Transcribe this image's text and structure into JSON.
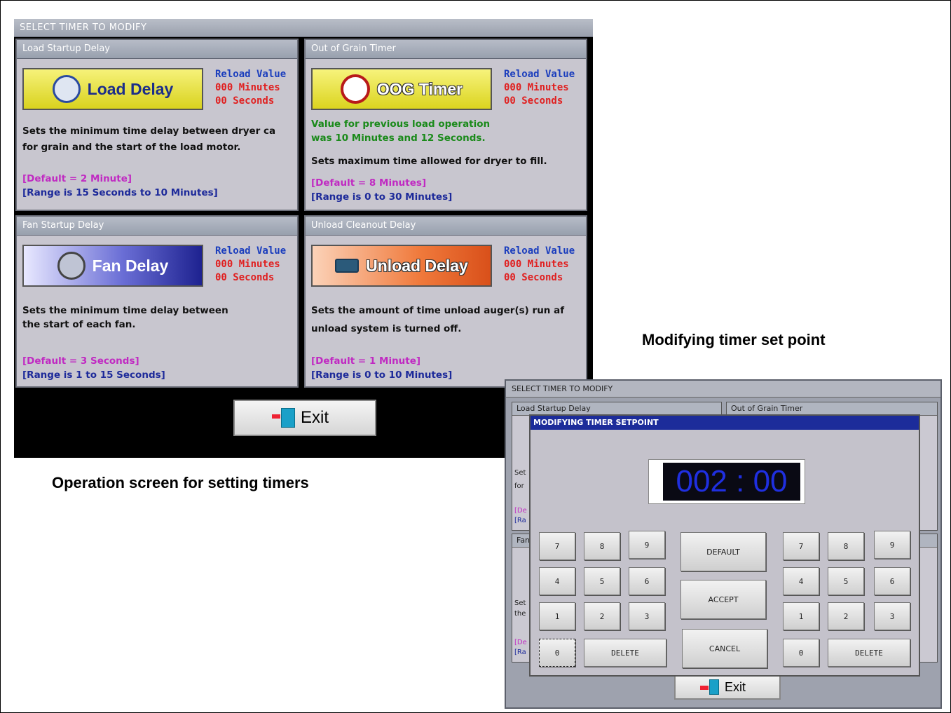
{
  "main": {
    "title": "SELECT TIMER TO MODIFY",
    "panels": [
      {
        "head": "Load Startup Delay",
        "button": "Load Delay",
        "reload": [
          "Reload Value",
          "000 Minutes",
          "00 Seconds"
        ],
        "desc1": "Sets the minimum time delay between dryer ca",
        "desc2": "for grain and the start of the load motor.",
        "default": "[Default = 2 Minute]",
        "range": "[Range is 15 Seconds to 10 Minutes]"
      },
      {
        "head": "Out of Grain Timer",
        "button": "OOG Timer",
        "reload": [
          "Reload Value",
          "000 Minutes",
          "00 Seconds"
        ],
        "prev1": "Value for previous load operation",
        "prev2": "was 10 Minutes and 12 Seconds.",
        "desc1": "Sets maximum time allowed for dryer to fill.",
        "default": "[Default = 8 Minutes]",
        "range": "[Range is 0 to 30 Minutes]"
      },
      {
        "head": "Fan Startup Delay",
        "button": "Fan Delay",
        "reload": [
          "Reload Value",
          "000 Minutes",
          "00 Seconds"
        ],
        "desc1": "Sets the minimum time delay between",
        "desc2": "the start of each fan.",
        "default": "[Default = 3 Seconds]",
        "range": "[Range is 1 to 15 Seconds]"
      },
      {
        "head": "Unload Cleanout Delay",
        "button": "Unload Delay",
        "reload": [
          "Reload Value",
          "000 Minutes",
          "00 Seconds"
        ],
        "desc1": "Sets the amount of time unload auger(s) run af",
        "desc2": "unload system is turned off.",
        "default": "[Default = 1 Minute]",
        "range": "[Range is 0 to 10 Minutes]"
      }
    ],
    "exit": "Exit"
  },
  "captions": {
    "left": "Operation screen for setting timers",
    "right": "Modifying timer set point"
  },
  "mod": {
    "title": "SELECT TIMER TO MODIFY",
    "panel_left": "Load Startup Delay",
    "panel_right": "Out of Grain Timer",
    "frag_set": "Set",
    "frag_for": "for",
    "frag_de": "[De",
    "frag_ra": "[Ra",
    "frag_fan": "Fan",
    "frag_set2": "Set",
    "frag_the": "the",
    "frag_de2": "[De",
    "frag_ra2": "[Ra",
    "dialog_title": "MODIFYING TIMER SETPOINT",
    "display": "002 : 00",
    "keys_left": [
      "7",
      "8",
      "9",
      "4",
      "5",
      "6",
      "1",
      "2",
      "3",
      "0"
    ],
    "keys_right": [
      "7",
      "8",
      "9",
      "4",
      "5",
      "6",
      "1",
      "2",
      "3",
      "0"
    ],
    "delete": "DELETE",
    "default": "DEFAULT",
    "accept": "ACCEPT",
    "cancel": "CANCEL",
    "exit": "Exit"
  }
}
